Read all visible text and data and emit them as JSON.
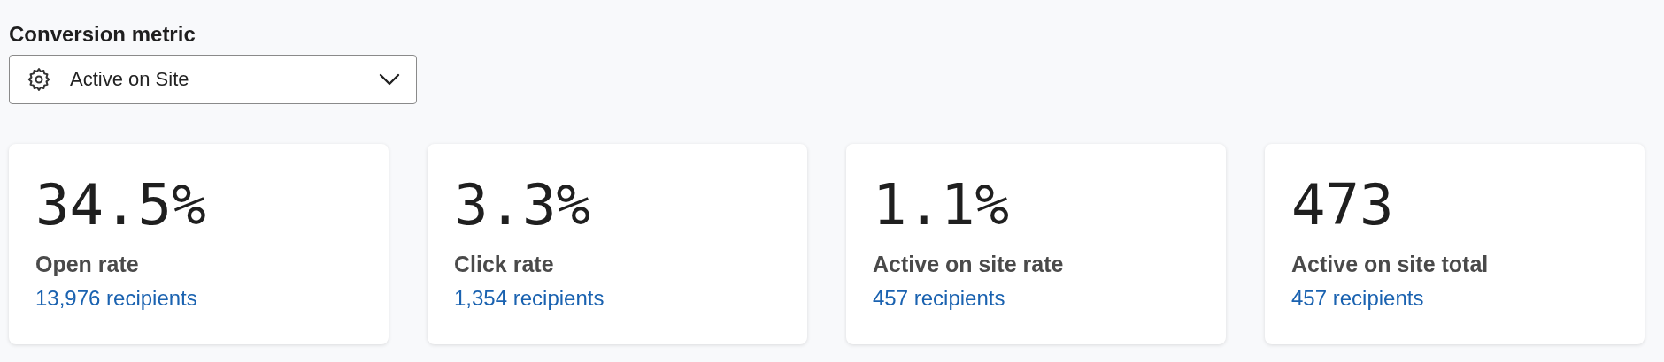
{
  "conversion_metric": {
    "label": "Conversion metric",
    "value": "Active on Site"
  },
  "cards": [
    {
      "value": "34.5%",
      "label": "Open rate",
      "link": "13,976 recipients"
    },
    {
      "value": "3.3%",
      "label": "Click rate",
      "link": "1,354 recipients"
    },
    {
      "value": "1.1%",
      "label": "Active on site rate",
      "link": "457 recipients"
    },
    {
      "value": "473",
      "label": "Active on site total",
      "link": "457 recipients"
    }
  ]
}
